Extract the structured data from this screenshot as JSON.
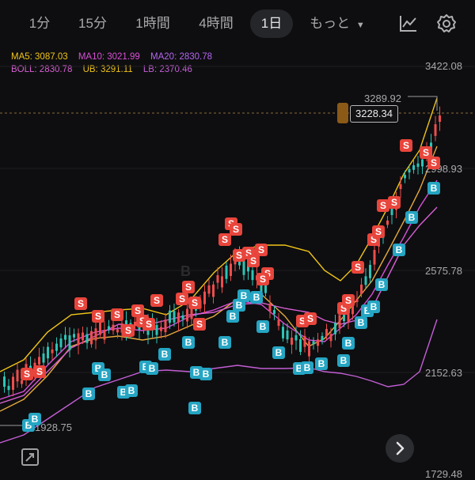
{
  "tabs": [
    {
      "label": "1分"
    },
    {
      "label": "15分"
    },
    {
      "label": "1時間"
    },
    {
      "label": "4時間"
    },
    {
      "label": "1日",
      "active": true
    },
    {
      "label": "もっと"
    }
  ],
  "icons": {
    "chart_type": "line-chart-icon",
    "settings": "gear-icon",
    "fullscreen": "expand-icon",
    "next": "chevron-right-icon"
  },
  "legend": {
    "ma5": "MA5: 3087.03",
    "ma10": "MA10: 3021.99",
    "ma20": "MA20: 2830.78",
    "boll": "BOLL: 2830.78",
    "ub": "UB: 3291.11",
    "lb": "LB: 2370.46"
  },
  "colors": {
    "ma5": "#f0c419",
    "ma10": "#d94fd6",
    "ma20": "#b565f0",
    "boll": "#d85fd4",
    "ub": "#f0c419",
    "lb": "#c45ed6",
    "up": "#2ec4b6",
    "down": "#ee4d4d",
    "sell": "#e8453c",
    "buy": "#25a5c3"
  },
  "price_axis": [
    "3422.08",
    "2998.93",
    "2575.78",
    "2152.63",
    "1729.48"
  ],
  "high_label": "3289.92",
  "low_label": "1928.75",
  "current_price": "3228.34",
  "watermark": "B",
  "signals": {
    "sell": "S",
    "buy": "B"
  }
}
